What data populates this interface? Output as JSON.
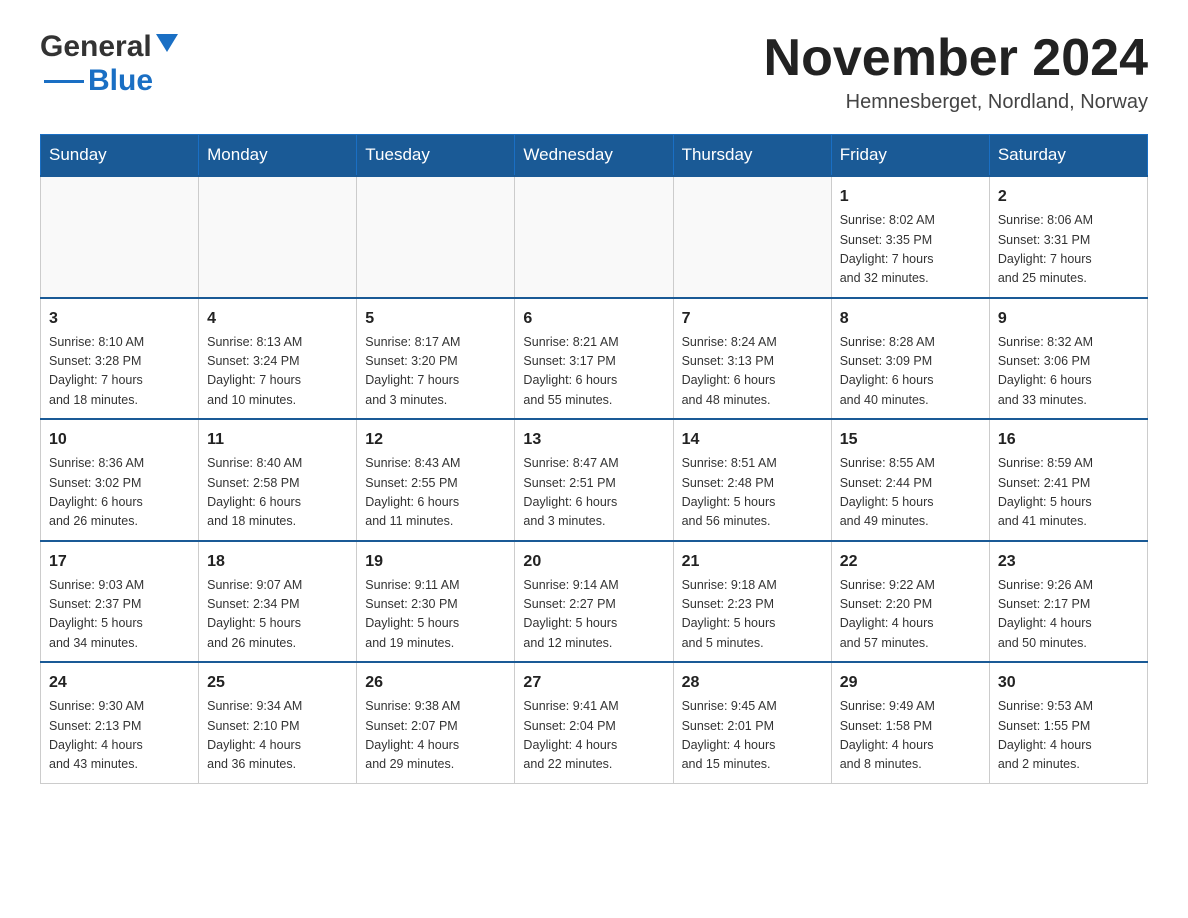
{
  "header": {
    "logo_general": "General",
    "logo_blue": "Blue",
    "month_title": "November 2024",
    "location": "Hemnesberget, Nordland, Norway"
  },
  "weekdays": [
    "Sunday",
    "Monday",
    "Tuesday",
    "Wednesday",
    "Thursday",
    "Friday",
    "Saturday"
  ],
  "weeks": [
    [
      {
        "day": "",
        "info": ""
      },
      {
        "day": "",
        "info": ""
      },
      {
        "day": "",
        "info": ""
      },
      {
        "day": "",
        "info": ""
      },
      {
        "day": "",
        "info": ""
      },
      {
        "day": "1",
        "info": "Sunrise: 8:02 AM\nSunset: 3:35 PM\nDaylight: 7 hours\nand 32 minutes."
      },
      {
        "day": "2",
        "info": "Sunrise: 8:06 AM\nSunset: 3:31 PM\nDaylight: 7 hours\nand 25 minutes."
      }
    ],
    [
      {
        "day": "3",
        "info": "Sunrise: 8:10 AM\nSunset: 3:28 PM\nDaylight: 7 hours\nand 18 minutes."
      },
      {
        "day": "4",
        "info": "Sunrise: 8:13 AM\nSunset: 3:24 PM\nDaylight: 7 hours\nand 10 minutes."
      },
      {
        "day": "5",
        "info": "Sunrise: 8:17 AM\nSunset: 3:20 PM\nDaylight: 7 hours\nand 3 minutes."
      },
      {
        "day": "6",
        "info": "Sunrise: 8:21 AM\nSunset: 3:17 PM\nDaylight: 6 hours\nand 55 minutes."
      },
      {
        "day": "7",
        "info": "Sunrise: 8:24 AM\nSunset: 3:13 PM\nDaylight: 6 hours\nand 48 minutes."
      },
      {
        "day": "8",
        "info": "Sunrise: 8:28 AM\nSunset: 3:09 PM\nDaylight: 6 hours\nand 40 minutes."
      },
      {
        "day": "9",
        "info": "Sunrise: 8:32 AM\nSunset: 3:06 PM\nDaylight: 6 hours\nand 33 minutes."
      }
    ],
    [
      {
        "day": "10",
        "info": "Sunrise: 8:36 AM\nSunset: 3:02 PM\nDaylight: 6 hours\nand 26 minutes."
      },
      {
        "day": "11",
        "info": "Sunrise: 8:40 AM\nSunset: 2:58 PM\nDaylight: 6 hours\nand 18 minutes."
      },
      {
        "day": "12",
        "info": "Sunrise: 8:43 AM\nSunset: 2:55 PM\nDaylight: 6 hours\nand 11 minutes."
      },
      {
        "day": "13",
        "info": "Sunrise: 8:47 AM\nSunset: 2:51 PM\nDaylight: 6 hours\nand 3 minutes."
      },
      {
        "day": "14",
        "info": "Sunrise: 8:51 AM\nSunset: 2:48 PM\nDaylight: 5 hours\nand 56 minutes."
      },
      {
        "day": "15",
        "info": "Sunrise: 8:55 AM\nSunset: 2:44 PM\nDaylight: 5 hours\nand 49 minutes."
      },
      {
        "day": "16",
        "info": "Sunrise: 8:59 AM\nSunset: 2:41 PM\nDaylight: 5 hours\nand 41 minutes."
      }
    ],
    [
      {
        "day": "17",
        "info": "Sunrise: 9:03 AM\nSunset: 2:37 PM\nDaylight: 5 hours\nand 34 minutes."
      },
      {
        "day": "18",
        "info": "Sunrise: 9:07 AM\nSunset: 2:34 PM\nDaylight: 5 hours\nand 26 minutes."
      },
      {
        "day": "19",
        "info": "Sunrise: 9:11 AM\nSunset: 2:30 PM\nDaylight: 5 hours\nand 19 minutes."
      },
      {
        "day": "20",
        "info": "Sunrise: 9:14 AM\nSunset: 2:27 PM\nDaylight: 5 hours\nand 12 minutes."
      },
      {
        "day": "21",
        "info": "Sunrise: 9:18 AM\nSunset: 2:23 PM\nDaylight: 5 hours\nand 5 minutes."
      },
      {
        "day": "22",
        "info": "Sunrise: 9:22 AM\nSunset: 2:20 PM\nDaylight: 4 hours\nand 57 minutes."
      },
      {
        "day": "23",
        "info": "Sunrise: 9:26 AM\nSunset: 2:17 PM\nDaylight: 4 hours\nand 50 minutes."
      }
    ],
    [
      {
        "day": "24",
        "info": "Sunrise: 9:30 AM\nSunset: 2:13 PM\nDaylight: 4 hours\nand 43 minutes."
      },
      {
        "day": "25",
        "info": "Sunrise: 9:34 AM\nSunset: 2:10 PM\nDaylight: 4 hours\nand 36 minutes."
      },
      {
        "day": "26",
        "info": "Sunrise: 9:38 AM\nSunset: 2:07 PM\nDaylight: 4 hours\nand 29 minutes."
      },
      {
        "day": "27",
        "info": "Sunrise: 9:41 AM\nSunset: 2:04 PM\nDaylight: 4 hours\nand 22 minutes."
      },
      {
        "day": "28",
        "info": "Sunrise: 9:45 AM\nSunset: 2:01 PM\nDaylight: 4 hours\nand 15 minutes."
      },
      {
        "day": "29",
        "info": "Sunrise: 9:49 AM\nSunset: 1:58 PM\nDaylight: 4 hours\nand 8 minutes."
      },
      {
        "day": "30",
        "info": "Sunrise: 9:53 AM\nSunset: 1:55 PM\nDaylight: 4 hours\nand 2 minutes."
      }
    ]
  ]
}
